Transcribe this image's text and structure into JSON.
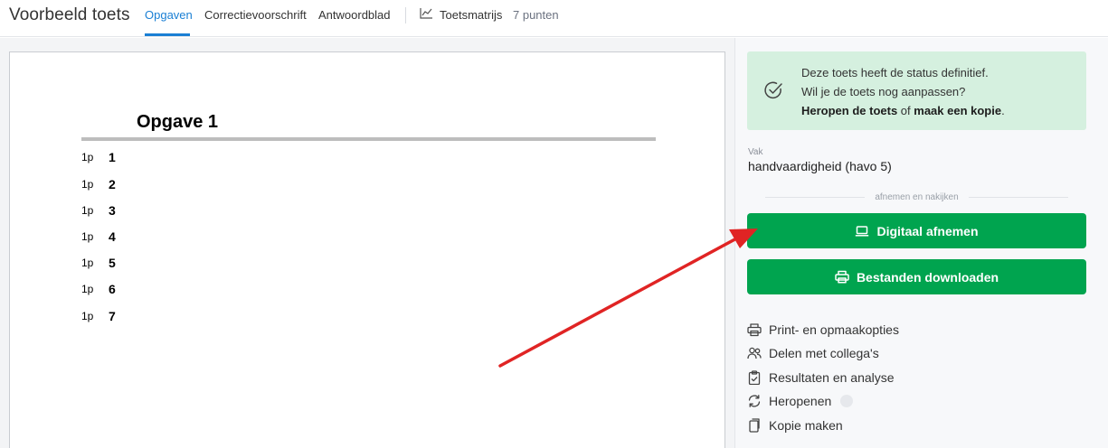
{
  "header": {
    "app_title": "Voorbeeld toets",
    "tabs": [
      {
        "label": "Opgaven",
        "active": true
      },
      {
        "label": "Correctievoorschrift",
        "active": false
      },
      {
        "label": "Antwoordblad",
        "active": false
      }
    ],
    "matrix_label": "Toetsmatrijs",
    "points_label": "7 punten"
  },
  "document": {
    "section_title": "Opgave 1",
    "questions": [
      {
        "points": "1p",
        "number": "1"
      },
      {
        "points": "1p",
        "number": "2"
      },
      {
        "points": "1p",
        "number": "3"
      },
      {
        "points": "1p",
        "number": "4"
      },
      {
        "points": "1p",
        "number": "5"
      },
      {
        "points": "1p",
        "number": "6"
      },
      {
        "points": "1p",
        "number": "7"
      }
    ]
  },
  "sidebar": {
    "status": {
      "line1": "Deze toets heeft de status definitief.",
      "line2": "Wil je de toets nog aanpassen?",
      "reopen_link": "Heropen de toets",
      "or_text": " of ",
      "copy_link": "maak een kopie",
      "end": "."
    },
    "vak_label": "Vak",
    "vak_value": "handvaardigheid (havo 5)",
    "divider_label": "afnemen en nakijken",
    "buttons": {
      "digital": "Digitaal afnemen",
      "download": "Bestanden downloaden"
    },
    "actions": [
      {
        "label": "Print- en opmaakopties",
        "icon": "printer-icon"
      },
      {
        "label": "Delen met collega's",
        "icon": "users-icon"
      },
      {
        "label": "Resultaten en analyse",
        "icon": "clipboard-check-icon"
      },
      {
        "label": "Heropenen",
        "icon": "refresh-icon"
      },
      {
        "label": "Kopie maken",
        "icon": "copy-icon"
      }
    ]
  },
  "colors": {
    "accent_blue": "#1a7fd4",
    "primary_green": "#00a44f",
    "status_bg": "#d5f0df",
    "annotation_red": "#e02424"
  }
}
